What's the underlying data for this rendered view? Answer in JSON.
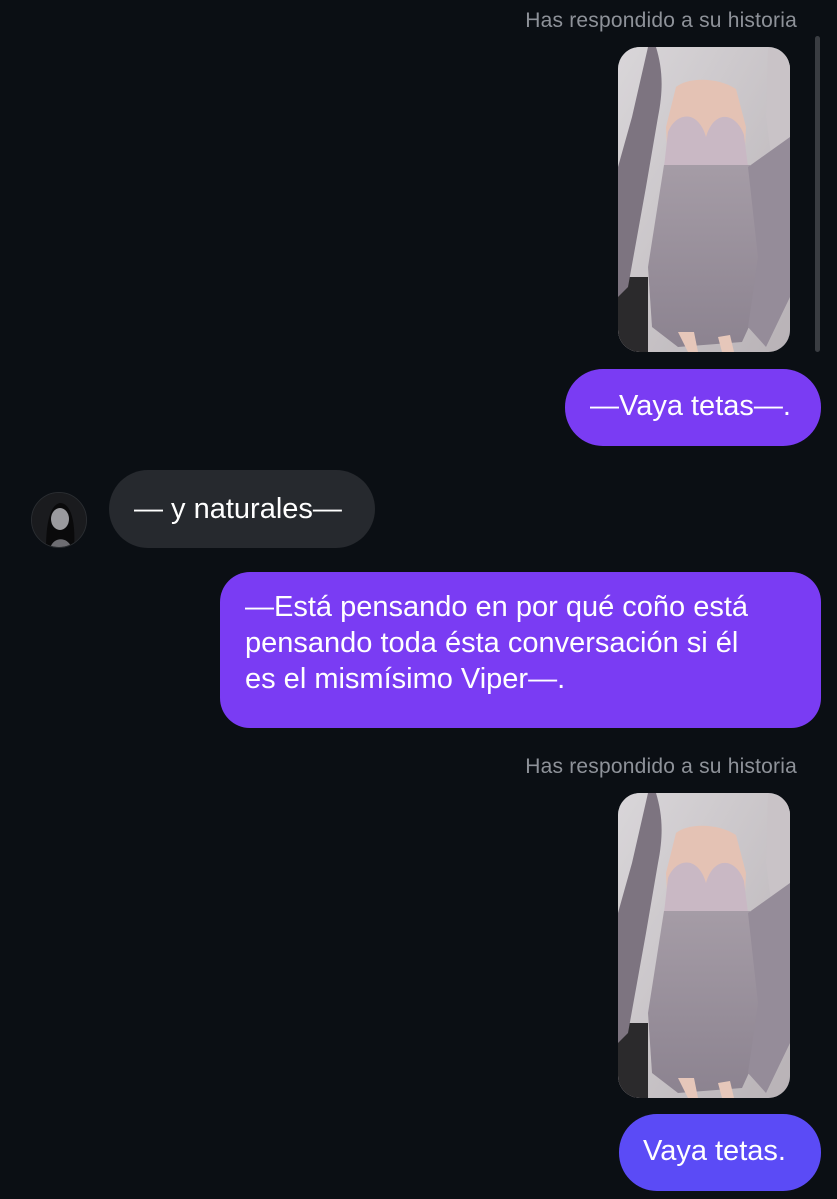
{
  "conversation": {
    "messages": [
      {
        "type": "story_reply",
        "label": "Has respondido a su historia",
        "thumbnail_icon": "story-thumbnail-image",
        "reply": "—Vaya tetas—."
      },
      {
        "type": "incoming",
        "avatar_icon": "contact-avatar",
        "text": "— y naturales—"
      },
      {
        "type": "outgoing",
        "lines": [
          "—Está pensando en por qué coño está",
          "pensando toda ésta conversación si él",
          "es el mismísimo Viper—."
        ]
      },
      {
        "type": "story_reply",
        "label": "Has respondido a su historia",
        "thumbnail_icon": "story-thumbnail-image",
        "reply": "Vaya tetas."
      }
    ]
  },
  "colors": {
    "background": "#0b0f14",
    "outgoing_bubble": "#7a3cf3",
    "outgoing_bubble_latest": "#5b4bf6",
    "incoming_bubble": "#26292e",
    "meta_text": "#8e9299"
  }
}
